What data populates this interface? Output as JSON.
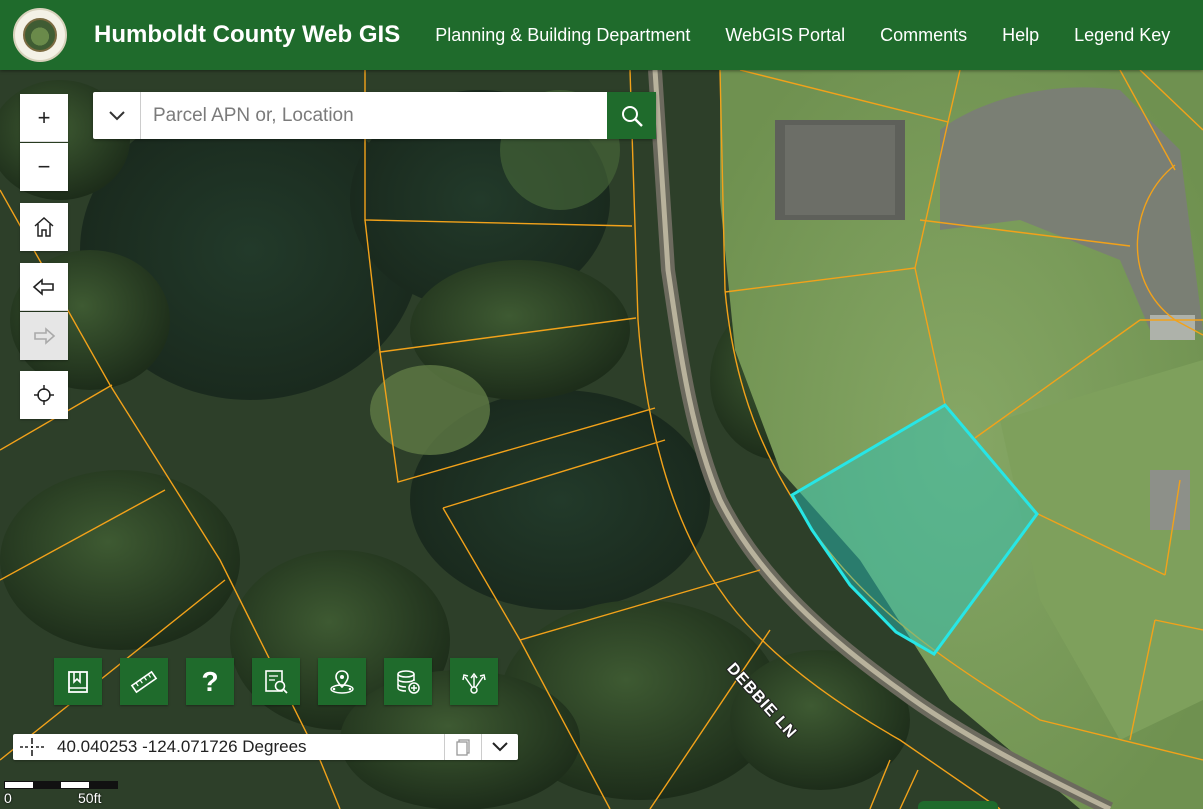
{
  "header": {
    "title": "Humboldt County Web GIS",
    "logo_text": "COUNTY of HUMBOLDT",
    "nav": [
      {
        "label": "Planning & Building Department"
      },
      {
        "label": "WebGIS Portal"
      },
      {
        "label": "Comments"
      },
      {
        "label": "Help"
      },
      {
        "label": "Legend Key"
      }
    ],
    "color": "#1f6b2c"
  },
  "search": {
    "placeholder": "Parcel APN or, Location",
    "value": ""
  },
  "controls": {
    "zoom_in": "+",
    "zoom_out": "−",
    "previous_extent_enabled": true,
    "next_extent_enabled": false
  },
  "tools": [
    {
      "icon": "bookmark-icon"
    },
    {
      "icon": "measure-ruler-icon"
    },
    {
      "icon": "help-icon",
      "label": "?"
    },
    {
      "icon": "query-list-icon"
    },
    {
      "icon": "select-by-location-icon"
    },
    {
      "icon": "add-data-icon"
    },
    {
      "icon": "share-icon"
    }
  ],
  "coordinates": {
    "value": "40.040253 -124.071726 Degrees"
  },
  "scale": {
    "start": "0",
    "end": "50ft"
  },
  "map": {
    "road_label": "DEBBIE LN",
    "selected_parcel_color": "#27e6e6",
    "parcel_line_color": "#f2a21a"
  }
}
